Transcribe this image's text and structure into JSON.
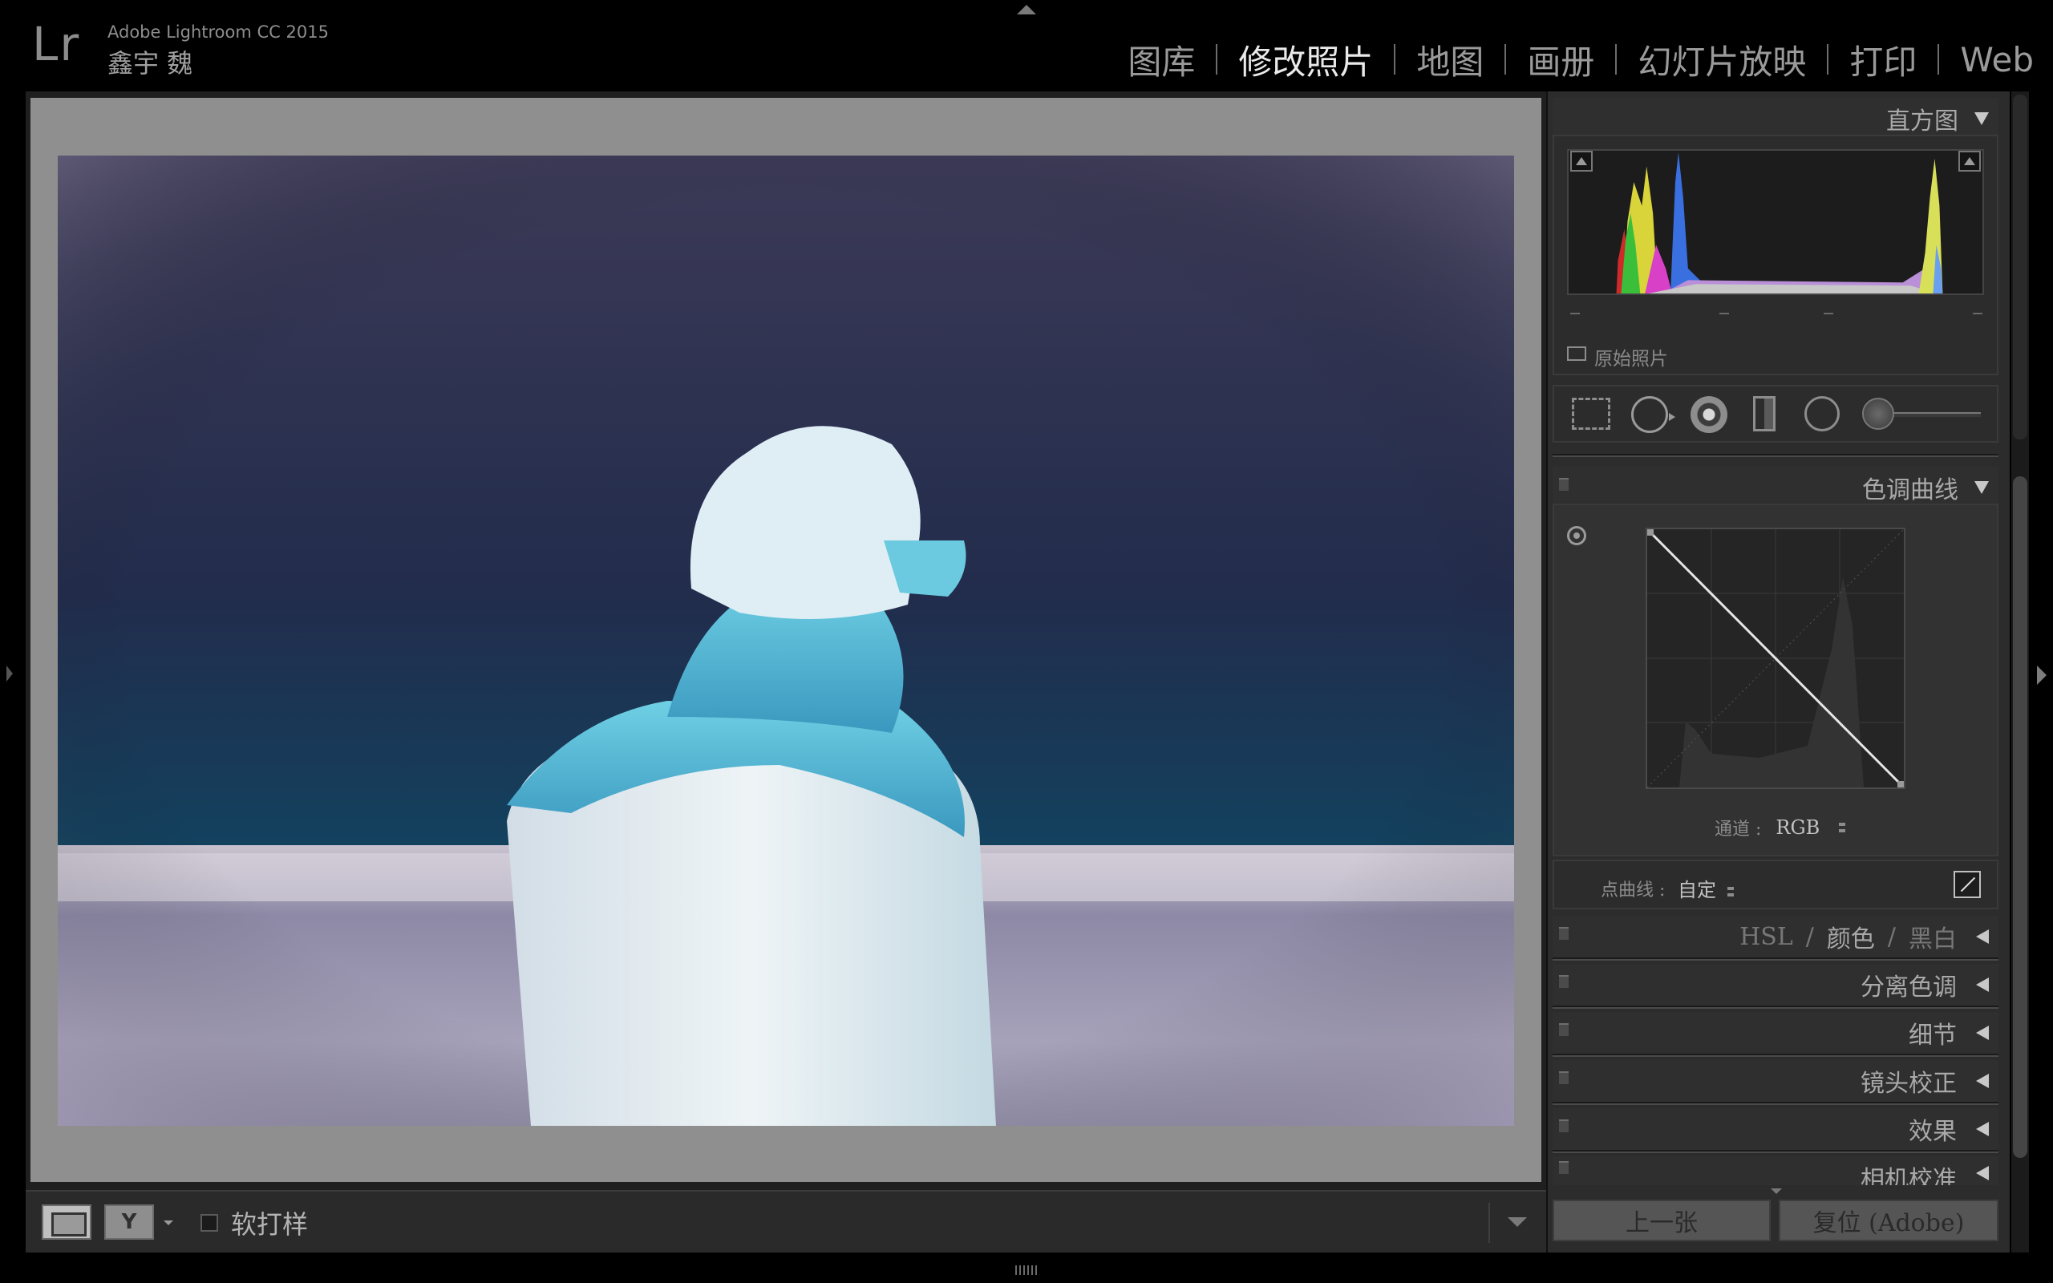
{
  "app": {
    "logo": "Lr",
    "product": "Adobe Lightroom CC 2015",
    "identity": "鑫宇 魏"
  },
  "modules": [
    {
      "label": "图库",
      "active": false
    },
    {
      "label": "修改照片",
      "active": true
    },
    {
      "label": "地图",
      "active": false
    },
    {
      "label": "画册",
      "active": false
    },
    {
      "label": "幻灯片放映",
      "active": false
    },
    {
      "label": "打印",
      "active": false
    },
    {
      "label": "Web",
      "active": false
    }
  ],
  "toolbar": {
    "softproof_label": "软打样",
    "view_before_after_glyph": "Y"
  },
  "panels": {
    "histogram": {
      "title": "直方图",
      "original_photo_label": "原始照片"
    },
    "tone_curve": {
      "title": "色调曲线",
      "channel_label": "通道 :",
      "channel_value": "RGB",
      "point_curve_label": "点曲线 :",
      "point_curve_value": "自定"
    },
    "hsl": {
      "hsl": "HSL",
      "sep": "/",
      "color": "颜色",
      "bw": "黑白"
    },
    "split_toning": {
      "title": "分离色调"
    },
    "detail": {
      "title": "细节"
    },
    "lens": {
      "title": "镜头校正"
    },
    "effects": {
      "title": "效果"
    },
    "camera": {
      "title": "相机校准"
    }
  },
  "buttons": {
    "previous": "上一张",
    "reset": "复位 (Adobe)"
  },
  "colors": {
    "accent_active": "#eaeaea",
    "panel_bg": "#2c2c2c",
    "canvas_gray": "#8f8f8f"
  }
}
